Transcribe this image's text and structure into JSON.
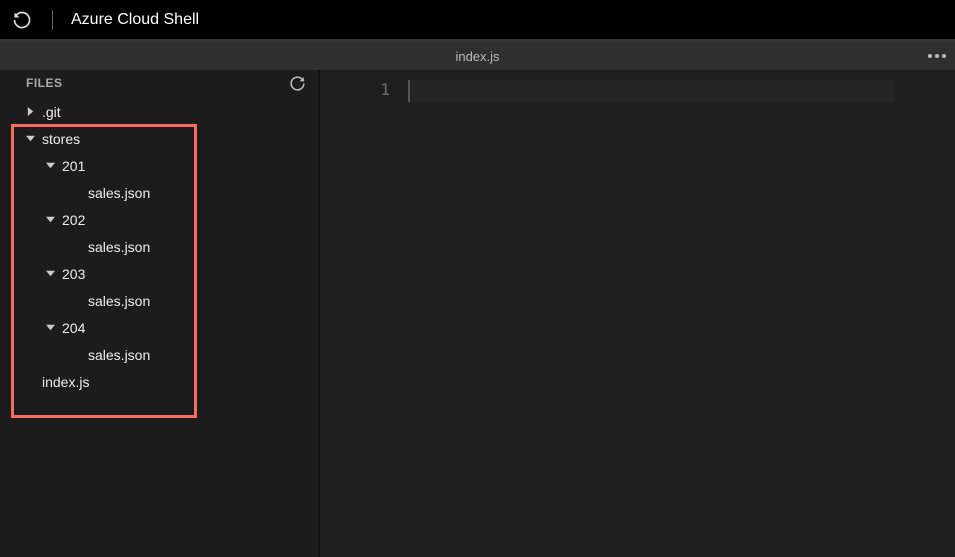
{
  "toolbar": {
    "title": "Azure Cloud Shell"
  },
  "tab": {
    "title": "index.js"
  },
  "sidebar": {
    "header": "FILES",
    "tree": [
      {
        "label": ".git",
        "indent": 0,
        "arrow": "right"
      },
      {
        "label": "stores",
        "indent": 0,
        "arrow": "down"
      },
      {
        "label": "201",
        "indent": 1,
        "arrow": "down"
      },
      {
        "label": "sales.json",
        "indent": 2,
        "arrow": ""
      },
      {
        "label": "202",
        "indent": 1,
        "arrow": "down"
      },
      {
        "label": "sales.json",
        "indent": 2,
        "arrow": ""
      },
      {
        "label": "203",
        "indent": 1,
        "arrow": "down"
      },
      {
        "label": "sales.json",
        "indent": 2,
        "arrow": ""
      },
      {
        "label": "204",
        "indent": 1,
        "arrow": "down"
      },
      {
        "label": "sales.json",
        "indent": 2,
        "arrow": ""
      },
      {
        "label": "index.js",
        "indent": 0,
        "arrow": ""
      }
    ]
  },
  "editor": {
    "lines": [
      "1"
    ]
  }
}
